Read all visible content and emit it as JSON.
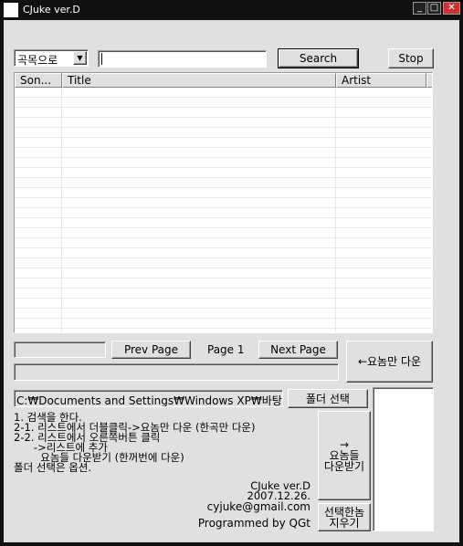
{
  "window": {
    "title": "CJuke ver.D",
    "icon_text": "ver.D"
  },
  "search": {
    "mode": "곡목으로",
    "query": "",
    "search_label": "Search",
    "stop_label": "Stop"
  },
  "list": {
    "columns": [
      "Son...",
      "Title",
      "Artist"
    ]
  },
  "paging": {
    "prev_label": "Prev Page",
    "page_text": "Page 1",
    "next_label": "Next Page",
    "download_one_label": "←요놈만 다운"
  },
  "folder": {
    "path": "C:₩Documents and Settings₩Windows XP₩바탕 화",
    "select_label": "폴더 선택"
  },
  "download_many_label": [
    "→",
    "요놈들",
    "다운받기"
  ],
  "remove_selected_label": [
    "선택한놈",
    "지우기"
  ],
  "instructions": [
    "1. 검색을 한다.",
    "2-1. 리스트에서 더블클릭->요놈만 다운 (한곡만 다운)",
    "2-2. 리스트에서 오른쪽버튼 클릭",
    "      ->리스트에 추가",
    "        요놈들 다운받기 (한꺼번에 다운)",
    "폴더 선택은 옵션."
  ],
  "credits": [
    "CJuke ver.D",
    "2007.12.26.",
    "cyjuke@gmail.com",
    "Programmed by QGt"
  ]
}
